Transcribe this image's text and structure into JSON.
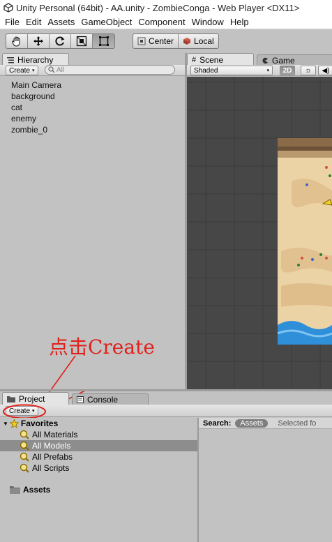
{
  "window": {
    "title": "Unity Personal (64bit) - AA.unity - ZombieConga - Web Player <DX11>"
  },
  "menu": [
    "File",
    "Edit",
    "Assets",
    "GameObject",
    "Component",
    "Window",
    "Help"
  ],
  "toolbar": {
    "tools": [
      "hand-icon",
      "move-icon",
      "rotate-icon",
      "scale-icon",
      "rect-tool-icon"
    ],
    "active_tool": "rect-tool-icon",
    "pivot_label": "Center",
    "space_label": "Local"
  },
  "hierarchy": {
    "tab_label": "Hierarchy",
    "create_label": "Create",
    "search_placeholder": "All",
    "items": [
      "Main Camera",
      "background",
      "cat",
      "enemy",
      "zombie_0"
    ]
  },
  "scene": {
    "tab_scene": "Scene",
    "tab_game": "Game",
    "shading_mode": "Shaded",
    "mode_2d": "2D"
  },
  "annotation": {
    "text": "点击Create",
    "color": "#e0201a"
  },
  "project": {
    "tab_project": "Project",
    "tab_console": "Console",
    "create_label": "Create",
    "favorites_label": "Favorites",
    "favorites": [
      "All Materials",
      "All Models",
      "All Prefabs",
      "All Scripts"
    ],
    "selected_favorite": "All Models",
    "assets_label": "Assets",
    "search_label": "Search:",
    "search_scope_selected": "Assets",
    "search_scope_other": "Selected fo"
  },
  "colors": {
    "editor_bg": "#c2c2c2",
    "scene_bg": "#474747",
    "sand": "#ecd3a6",
    "water": "#2f8fd9"
  }
}
